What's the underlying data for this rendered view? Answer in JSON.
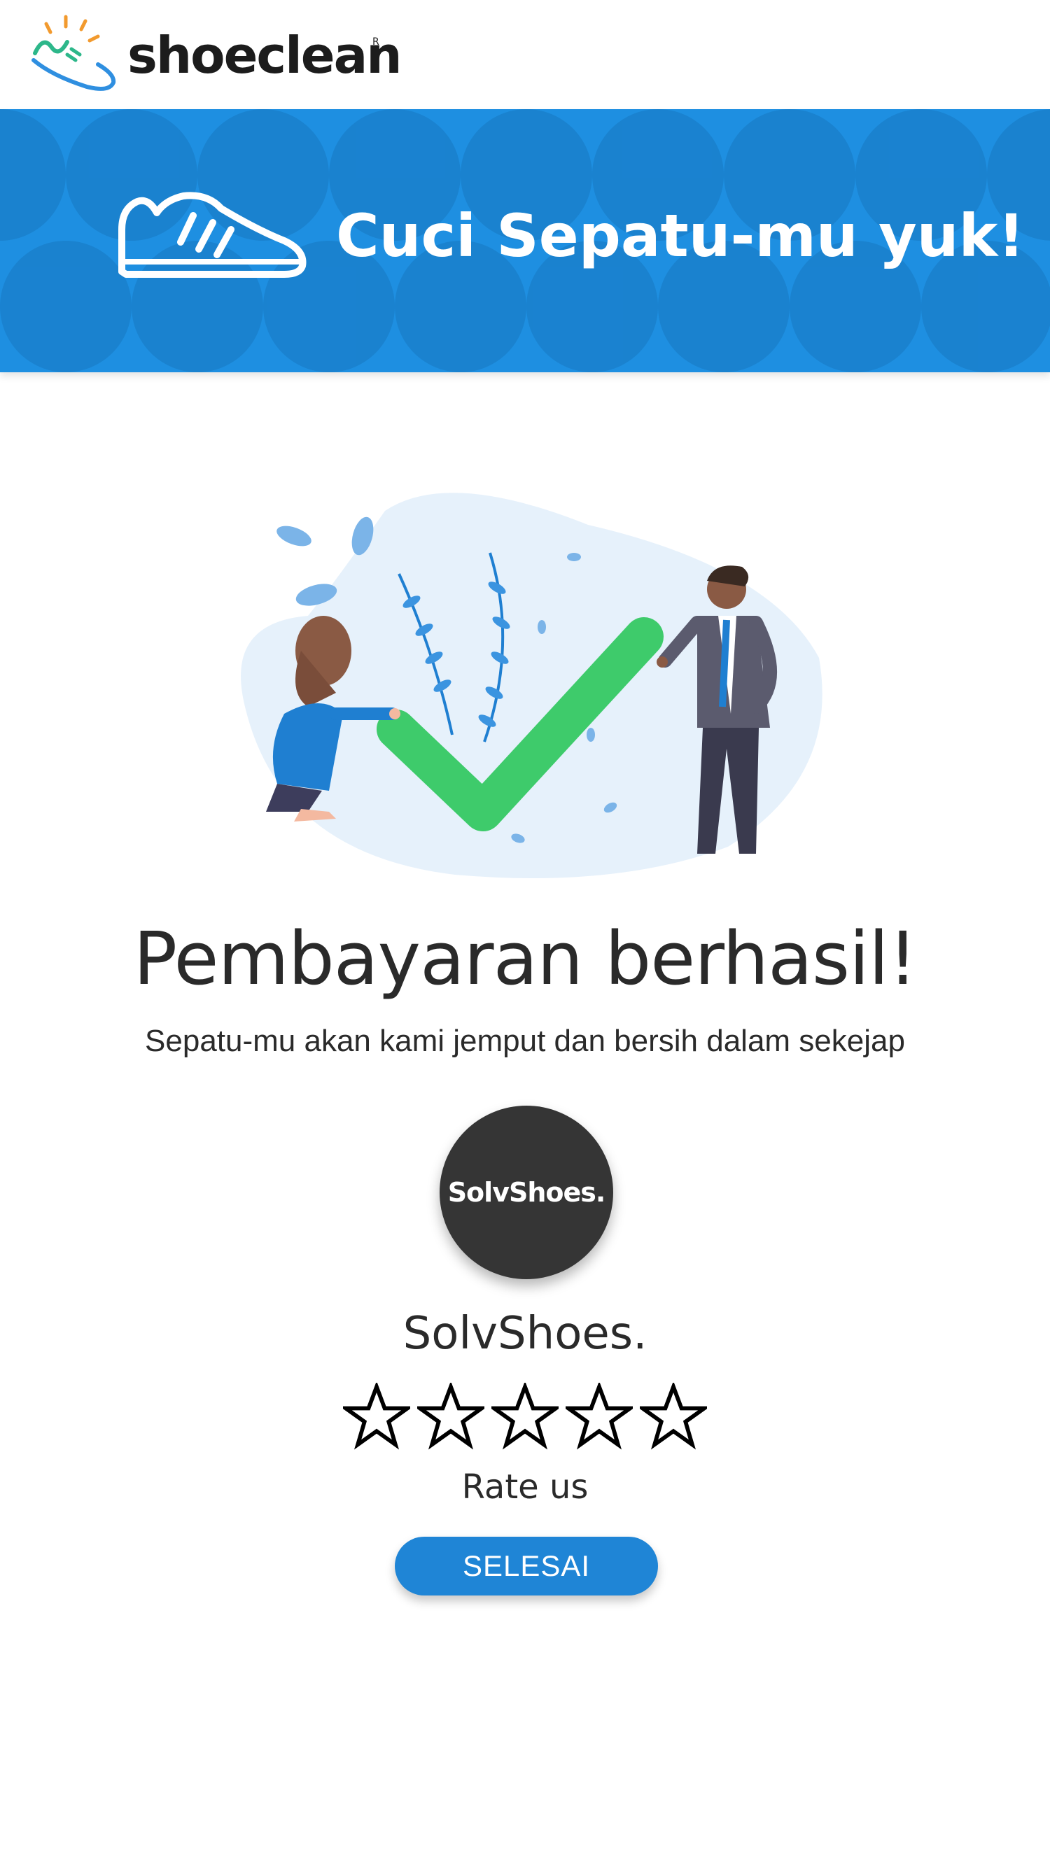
{
  "app": {
    "brand_name": "shoeclean",
    "brand_mark": "R",
    "logo_icon": "shoe-sparkle-icon"
  },
  "banner": {
    "title": "Cuci Sepatu-mu yuk!",
    "icon": "sneaker-icon",
    "background_color": "#1e8fe1"
  },
  "illustration": {
    "name": "payment-success-illustration",
    "accent_color": "#3ecb6b"
  },
  "status": {
    "title": "Pembayaran berhasil!",
    "subtitle": "Sepatu-mu akan kami jemput dan bersih dalam sekejap"
  },
  "shop": {
    "avatar_text": "SolvShoes.",
    "name": "SolvShoes."
  },
  "rating": {
    "max_stars": 5,
    "selected_stars": 0,
    "label": "Rate us"
  },
  "actions": {
    "done_label": "SELESAI",
    "button_color": "#1f85d6"
  }
}
